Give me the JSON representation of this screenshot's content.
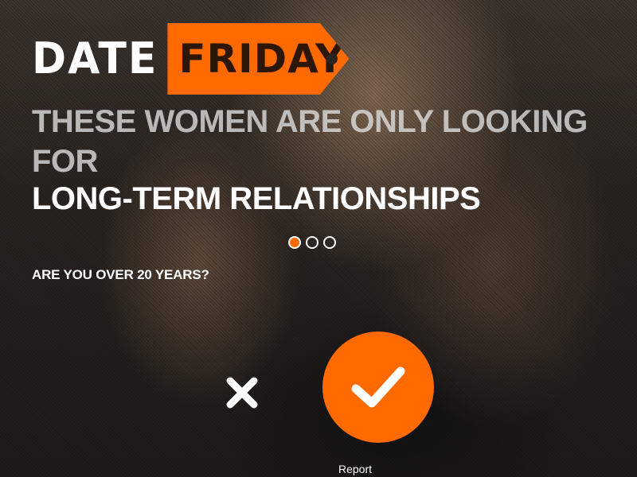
{
  "logo": {
    "word1": "DATE",
    "word2": "FRIDAY"
  },
  "headline": {
    "line1": "THESE WOMEN ARE ONLY LOOKING FOR",
    "line2": "LONG-TERM RELATIONSHIPS"
  },
  "progress": {
    "current_step": 1,
    "total_steps": 3
  },
  "question": "ARE YOU OVER 20 YEARS?",
  "buttons": {
    "no_icon": "close-icon",
    "yes_icon": "checkmark-icon"
  },
  "footer": {
    "report_label": "Report"
  },
  "colors": {
    "accent": "#ff6a00",
    "text": "#ffffff"
  }
}
